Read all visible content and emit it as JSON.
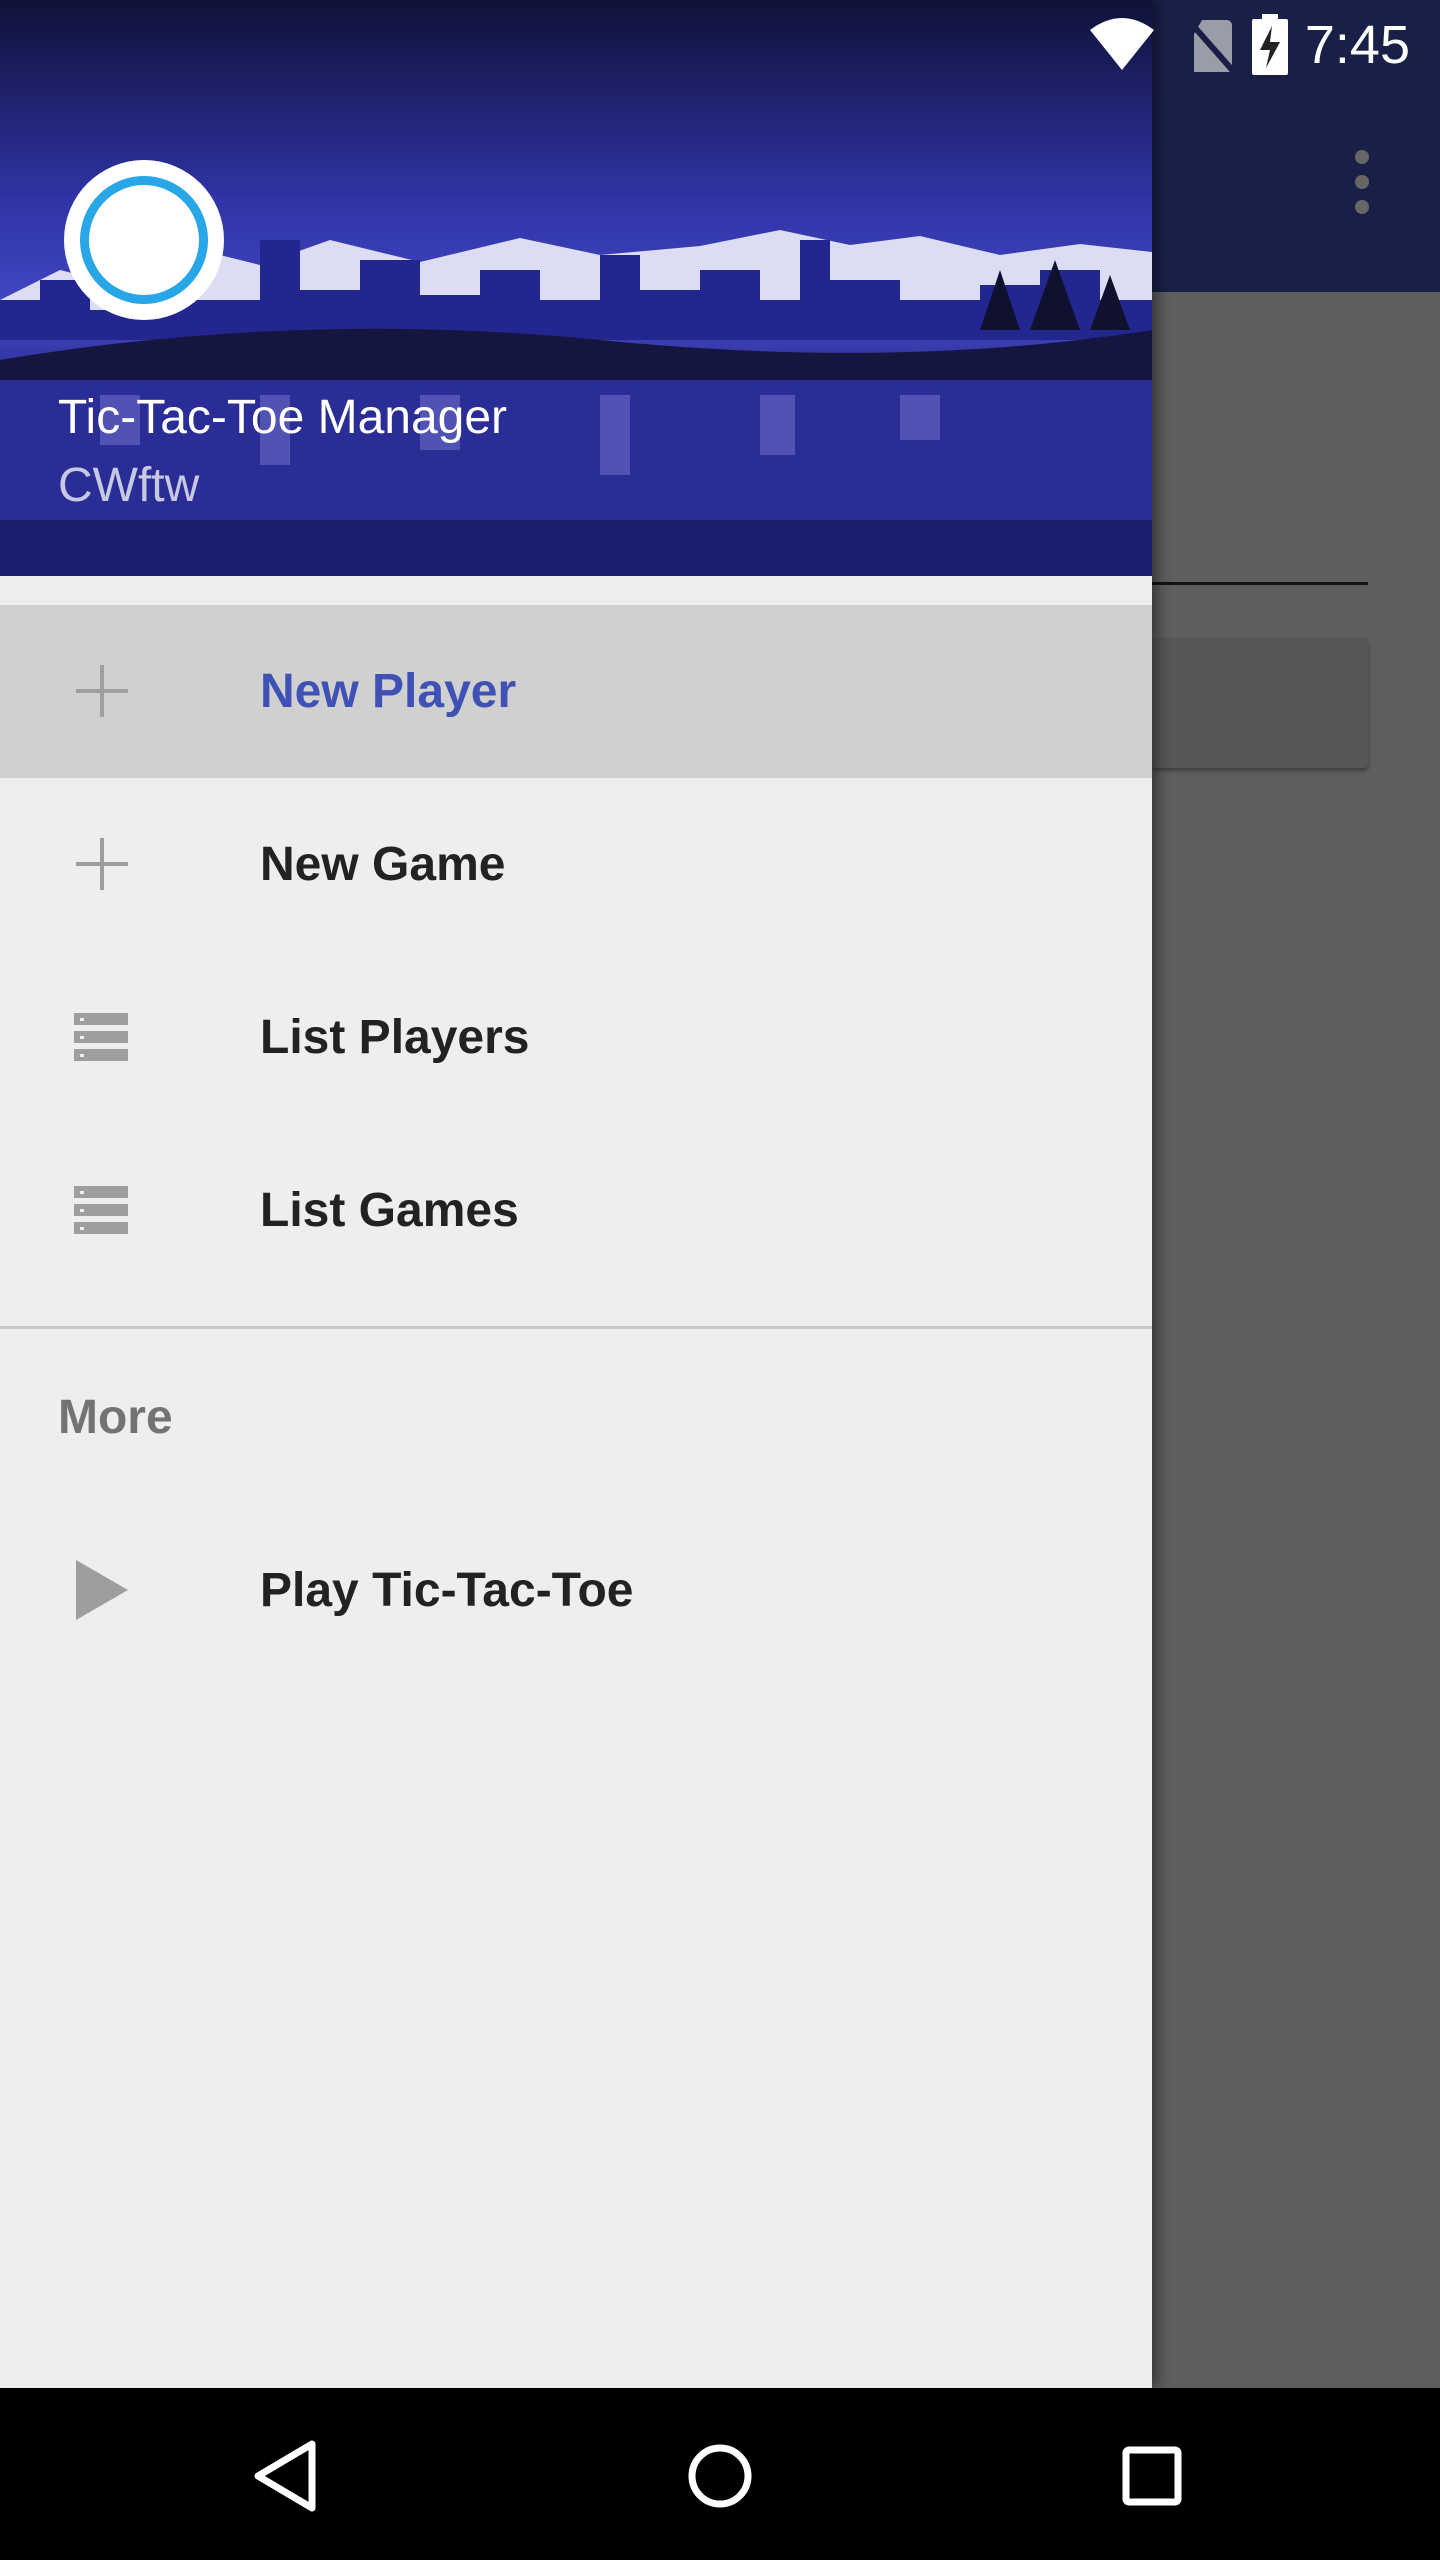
{
  "status_bar": {
    "time": "7:45",
    "icons": [
      "wifi-icon",
      "no-sim-icon",
      "battery-charging-icon"
    ]
  },
  "toolbar": {
    "overflow_icon": "more-vert-icon"
  },
  "drawer": {
    "header": {
      "title": "Tic-Tac-Toe Manager",
      "subtitle": "CWftw",
      "avatar_icon": "circle-avatar-icon"
    },
    "items": [
      {
        "label": "New Player",
        "icon": "plus-icon",
        "active": true
      },
      {
        "label": "New Game",
        "icon": "plus-icon",
        "active": false
      },
      {
        "label": "List Players",
        "icon": "list-icon",
        "active": false
      },
      {
        "label": "List Games",
        "icon": "list-icon",
        "active": false
      }
    ],
    "section_title": "More",
    "more_items": [
      {
        "label": "Play Tic-Tac-Toe",
        "icon": "play-icon"
      }
    ]
  },
  "nav_bar": {
    "buttons": [
      "back-icon",
      "home-icon",
      "recents-icon"
    ]
  },
  "colors": {
    "primary": "#3f51b5",
    "accent_ring": "#29a6e8",
    "drawer_bg": "#eeeeee",
    "active_bg": "#d0d0d0"
  }
}
